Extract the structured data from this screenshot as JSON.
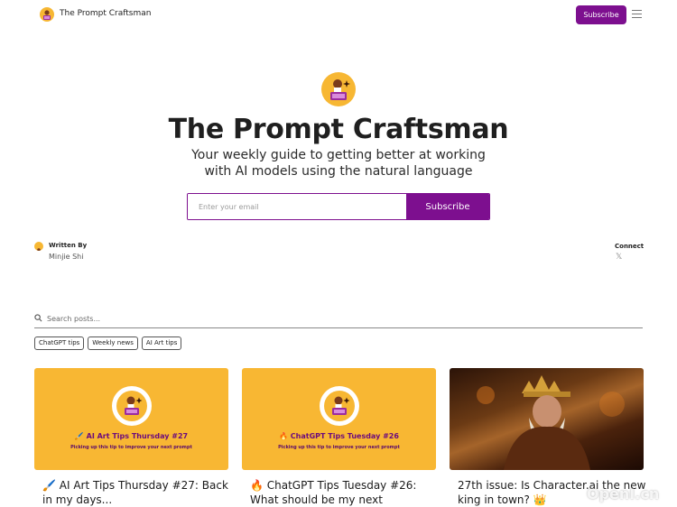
{
  "nav": {
    "brand": "The Prompt Craftsman",
    "subscribe_label": "Subscribe"
  },
  "hero": {
    "title": "The Prompt Craftsman",
    "subtitle": "Your weekly guide to getting better at working with AI models using the natural language",
    "email_placeholder": "Enter your email",
    "subscribe_label": "Subscribe"
  },
  "author": {
    "written_by_label": "Written By",
    "name": "Minjie Shi"
  },
  "connect": {
    "label": "Connect",
    "x_glyph": "𝕏"
  },
  "search": {
    "placeholder": "Search posts..."
  },
  "tags": [
    "ChatGPT tips",
    "Weekly news",
    "AI Art tips"
  ],
  "posts": [
    {
      "image_title": "🖌️ AI Art Tips Thursday #27",
      "image_subtitle": "Picking up this tip to improve your next prompt",
      "headline": "🖌️ AI Art Tips Thursday #27: Back in my days..."
    },
    {
      "image_title": "🔥 ChatGPT Tips Tuesday #26",
      "image_subtitle": "Picking up this tip to improve your next prompt",
      "headline": "🔥 ChatGPT Tips Tuesday #26: What should be my next"
    },
    {
      "headline": "27th issue: Is Character.ai the new king in town? 👑"
    }
  ],
  "watermark": "OpenI.cn",
  "colors": {
    "accent": "#7d0f8f",
    "card_bg": "#f8b733",
    "card_title": "#6b0a7d"
  }
}
